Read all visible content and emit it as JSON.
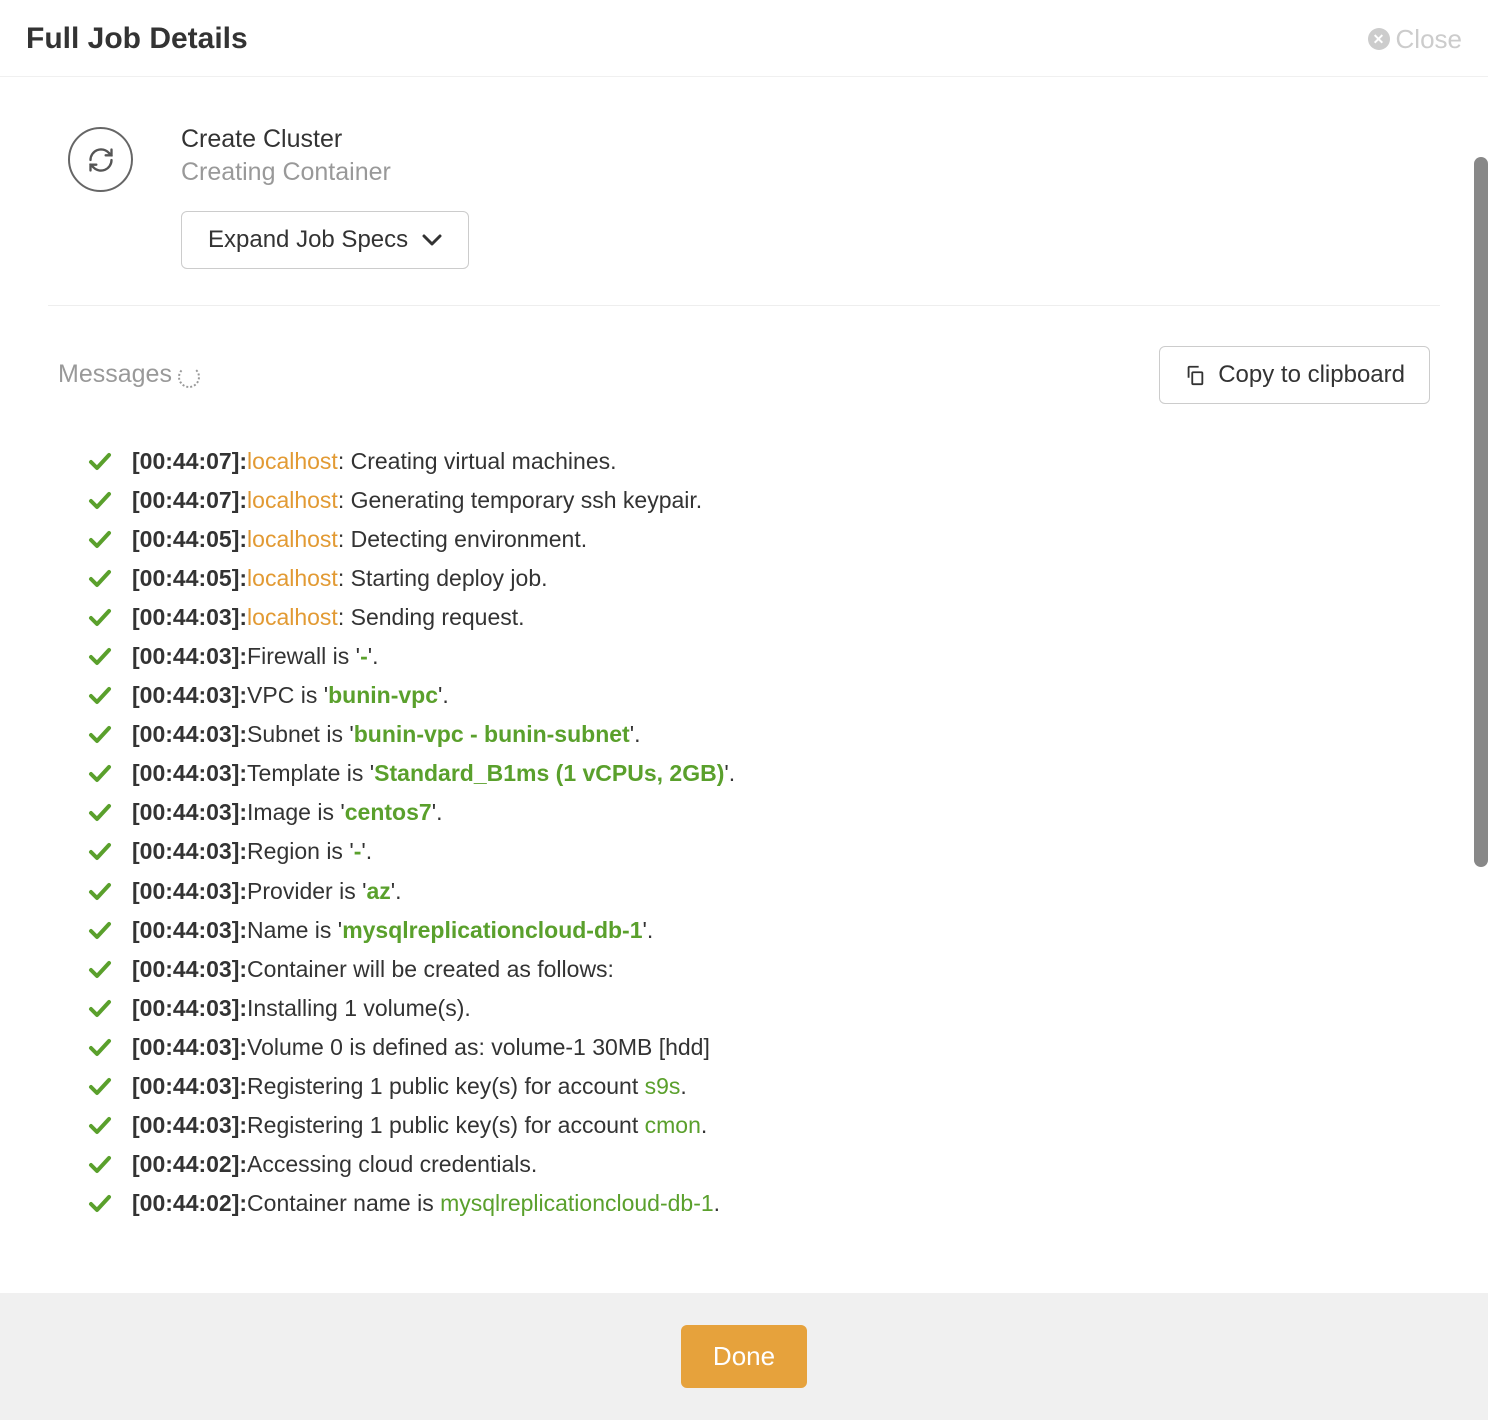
{
  "header": {
    "title": "Full Job Details",
    "close_label": "Close"
  },
  "job": {
    "title": "Create Cluster",
    "subtitle": "Creating Container",
    "expand_label": "Expand Job Specs"
  },
  "messages": {
    "label": "Messages",
    "copy_label": "Copy to clipboard",
    "logs": [
      {
        "ts": "[00:44:07]:",
        "host": "localhost",
        "pre": ": ",
        "msg": "Creating virtual machines."
      },
      {
        "ts": "[00:44:07]:",
        "host": "localhost",
        "pre": ": ",
        "msg": "Generating temporary ssh keypair."
      },
      {
        "ts": "[00:44:05]:",
        "host": "localhost",
        "pre": ": ",
        "msg": "Detecting environment."
      },
      {
        "ts": "[00:44:05]:",
        "host": "localhost",
        "pre": ": ",
        "msg": "Starting deploy job."
      },
      {
        "ts": "[00:44:03]:",
        "host": "localhost",
        "pre": ": ",
        "msg": "Sending request."
      },
      {
        "ts": "[00:44:03]:",
        "pre": "Firewall is '",
        "val": "-",
        "post": "'."
      },
      {
        "ts": "[00:44:03]:",
        "pre": "VPC is '",
        "val": "bunin-vpc",
        "post": "'."
      },
      {
        "ts": "[00:44:03]:",
        "pre": "Subnet is '",
        "val": "bunin-vpc - bunin-subnet",
        "post": "'."
      },
      {
        "ts": "[00:44:03]:",
        "pre": "Template is '",
        "val": "Standard_B1ms (1 vCPUs, 2GB)",
        "post": "'."
      },
      {
        "ts": "[00:44:03]:",
        "pre": "Image is '",
        "val": "centos7",
        "post": "'."
      },
      {
        "ts": "[00:44:03]:",
        "pre": "Region is '",
        "val": "-",
        "post": "'."
      },
      {
        "ts": "[00:44:03]:",
        "pre": "Provider is '",
        "val": "az",
        "post": "'."
      },
      {
        "ts": "[00:44:03]:",
        "pre": "Name is '",
        "val": "mysqlreplicationcloud-db-1",
        "post": "'."
      },
      {
        "ts": "[00:44:03]:",
        "msg": "Container will be created as follows:"
      },
      {
        "ts": "[00:44:03]:",
        "msg": "Installing 1 volume(s)."
      },
      {
        "ts": "[00:44:03]:",
        "msg": "Volume 0 is defined as: volume-1 30MB [hdd]"
      },
      {
        "ts": "[00:44:03]:",
        "pre": "Registering 1 public key(s) for account ",
        "link": "s9s",
        "post": "."
      },
      {
        "ts": "[00:44:03]:",
        "pre": "Registering 1 public key(s) for account ",
        "link": "cmon",
        "post": "."
      },
      {
        "ts": "[00:44:02]:",
        "msg": "Accessing cloud credentials."
      },
      {
        "ts": "[00:44:02]:",
        "pre": "Container name is ",
        "link": "mysqlreplicationcloud-db-1",
        "post": "."
      }
    ]
  },
  "footer": {
    "done_label": "Done"
  }
}
